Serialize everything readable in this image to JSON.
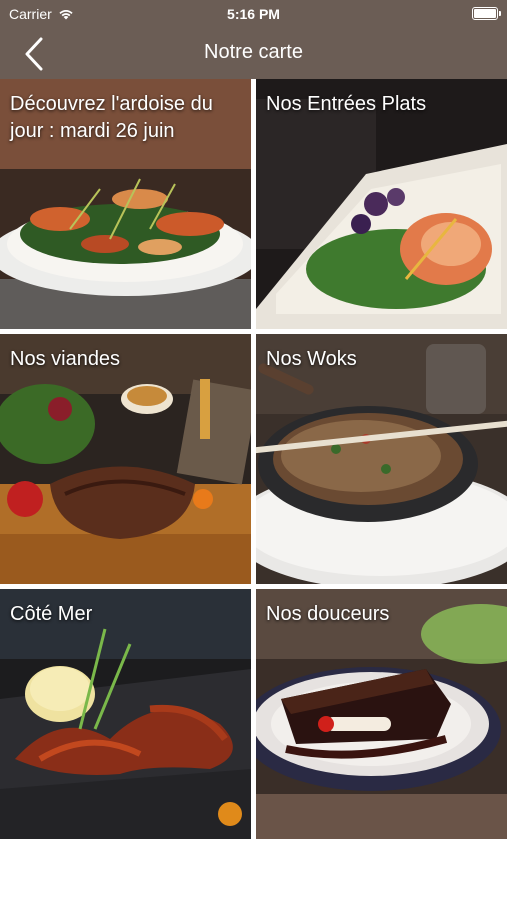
{
  "status": {
    "carrier": "Carrier",
    "time": "5:16 PM"
  },
  "navbar": {
    "title": "Notre carte",
    "back_icon": "chevron-left-icon"
  },
  "tiles": [
    {
      "label": "Découvrez l'ardoise du jour : mardi 26 juin"
    },
    {
      "label": "Nos Entrées Plats"
    },
    {
      "label": "Nos viandes"
    },
    {
      "label": "Nos Woks"
    },
    {
      "label": "Côté Mer"
    },
    {
      "label": "Nos douceurs"
    }
  ],
  "colors": {
    "bar": "#6b5d55",
    "text": "#ffffff"
  }
}
